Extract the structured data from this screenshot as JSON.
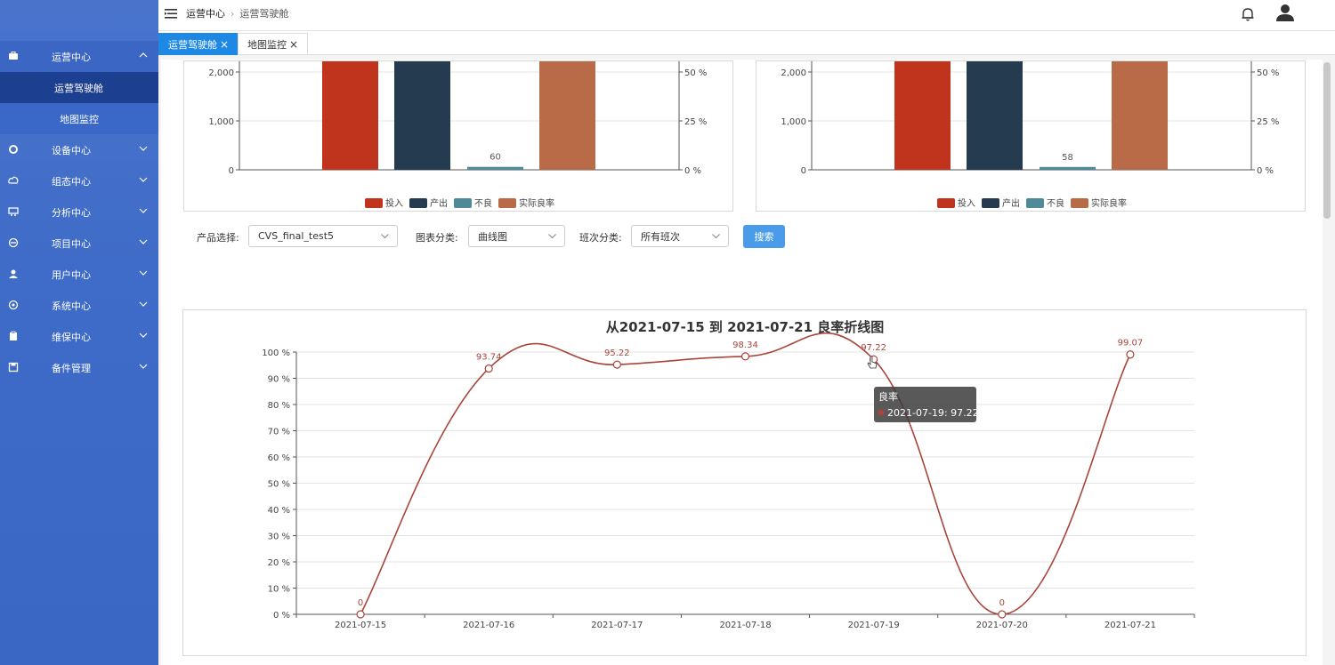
{
  "header": {
    "breadcrumb": [
      "运营中心",
      "运营驾驶舱"
    ]
  },
  "tabs": [
    {
      "label": "运营驾驶舱",
      "active": true
    },
    {
      "label": "地图监控",
      "active": false
    }
  ],
  "sidebar": {
    "items": [
      {
        "label": "运营中心",
        "icon": "briefcase-icon",
        "open": true,
        "children": [
          "运营驾驶舱",
          "地图监控"
        ]
      },
      {
        "label": "设备中心",
        "icon": "gear-icon"
      },
      {
        "label": "组态中心",
        "icon": "cloud-icon"
      },
      {
        "label": "分析中心",
        "icon": "cart-icon"
      },
      {
        "label": "项目中心",
        "icon": "dashboard-icon"
      },
      {
        "label": "用户中心",
        "icon": "user-icon"
      },
      {
        "label": "系统中心",
        "icon": "settings-icon"
      },
      {
        "label": "维保中心",
        "icon": "clipboard-icon"
      },
      {
        "label": "备件管理",
        "icon": "save-icon"
      }
    ]
  },
  "filters": {
    "product_label": "产品选择:",
    "product_value": "CVS_final_test5",
    "chart_type_label": "图表分类:",
    "chart_type_value": "曲线图",
    "shift_label": "班次分类:",
    "shift_value": "所有班次",
    "search_button": "搜索"
  },
  "chart_data": [
    {
      "type": "bar",
      "categories": [
        "投入",
        "产出",
        "不良",
        "实际良率"
      ],
      "left_axis_ticks": [
        "0",
        "1,000",
        "2,000"
      ],
      "right_axis_ticks": [
        "0 %",
        "25 %",
        "50 %"
      ],
      "series": [
        {
          "name": "投入",
          "color": "#c0341e"
        },
        {
          "name": "产出",
          "color": "#243b50"
        },
        {
          "name": "不良",
          "color": "#4e8a98",
          "value": 60
        },
        {
          "name": "实际良率",
          "color": "#b96b47"
        }
      ],
      "legend": "bottom-center"
    },
    {
      "type": "bar",
      "categories": [
        "投入",
        "产出",
        "不良",
        "实际良率"
      ],
      "left_axis_ticks": [
        "0",
        "1,000",
        "2,000"
      ],
      "right_axis_ticks": [
        "0 %",
        "25 %",
        "50 %"
      ],
      "series": [
        {
          "name": "投入",
          "color": "#c0341e"
        },
        {
          "name": "产出",
          "color": "#243b50"
        },
        {
          "name": "不良",
          "color": "#4e8a98",
          "value": 58
        },
        {
          "name": "实际良率",
          "color": "#b96b47"
        }
      ],
      "legend": "bottom-center"
    },
    {
      "type": "line",
      "title": "从2021-07-15 到 2021-07-21 良率折线图",
      "x": [
        "2021-07-15",
        "2021-07-16",
        "2021-07-17",
        "2021-07-18",
        "2021-07-19",
        "2021-07-20",
        "2021-07-21"
      ],
      "series": [
        {
          "name": "良率",
          "values": [
            0,
            93.74,
            95.22,
            98.34,
            97.22,
            0,
            99.07
          ],
          "color": "#a8453b"
        }
      ],
      "y_ticks": [
        "0 %",
        "10 %",
        "20 %",
        "30 %",
        "40 %",
        "50 %",
        "60 %",
        "70 %",
        "80 %",
        "90 %",
        "100 %"
      ],
      "ylim": [
        0,
        100
      ],
      "grid": true,
      "tooltip": {
        "title": "良率",
        "text": "2021-07-19: 97.22"
      }
    }
  ]
}
